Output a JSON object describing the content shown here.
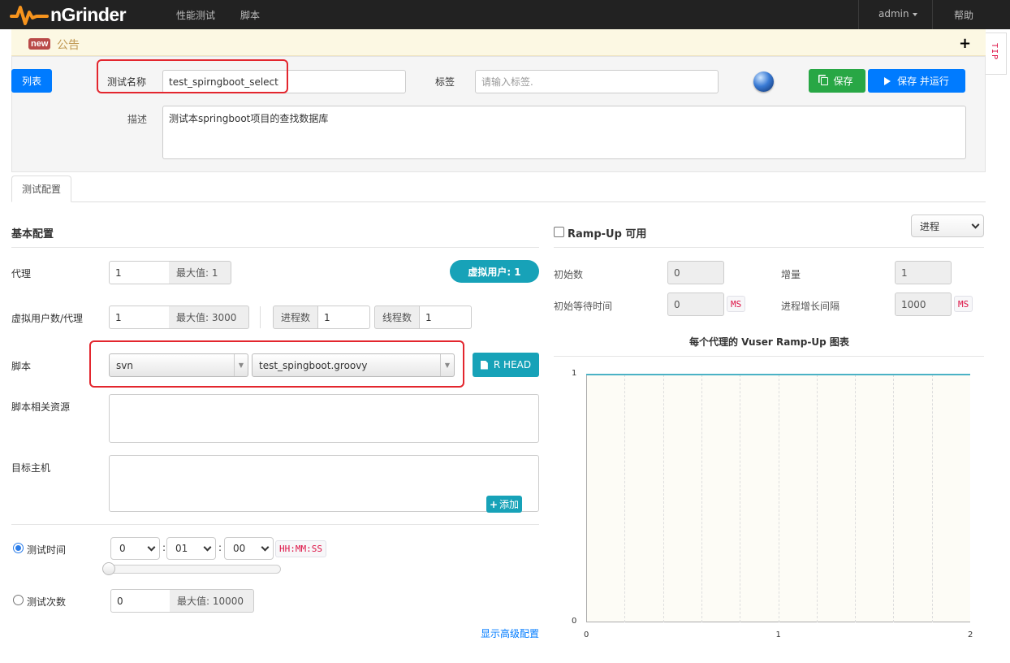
{
  "navbar": {
    "brand": "nGrinder",
    "links": [
      "性能测试",
      "脚本"
    ],
    "user": "admin",
    "help": "帮助"
  },
  "notice": {
    "badge": "new",
    "title": "公告",
    "expand": "+",
    "tip": "TIP"
  },
  "header": {
    "list_button": "列表",
    "test_name_label": "测试名称",
    "test_name_value": "test_spirngboot_select",
    "tag_label": "标签",
    "tag_placeholder": "请输入标签.",
    "save_button": "保存",
    "save_run_button": "保存 并运行",
    "desc_label": "描述",
    "desc_value": "测试本springboot项目的查找数据库"
  },
  "tabs": [
    "测试配置"
  ],
  "basic": {
    "title": "基本配置",
    "agent_label": "代理",
    "agent_value": "1",
    "agent_max": "最大值: 1",
    "vuser_badge": "虚拟用户: 1",
    "vuser_per_agent_label": "虚拟用户数/代理",
    "vuser_value": "1",
    "vuser_max": "最大值: 3000",
    "process_label": "进程数",
    "process_value": "1",
    "thread_label": "线程数",
    "thread_value": "1",
    "script_label": "脚本",
    "script_repo": "svn",
    "script_file": "test_spingboot.groovy",
    "rhead_button": "R HEAD",
    "resources_label": "脚本相关资源",
    "target_host_label": "目标主机",
    "add_button": "添加",
    "duration_label": "测试时间",
    "duration_h": "0",
    "duration_m": "01",
    "duration_s": "00",
    "duration_format": "HH:MM:SS",
    "duration_selected": true,
    "run_count_label": "测试次数",
    "run_count_value": "0",
    "run_count_max": "最大值: 10000",
    "advanced_link": "显示高级配置"
  },
  "rampup": {
    "enable_label": "Ramp-Up 可用",
    "enabled": false,
    "type_select": "进程",
    "initial_count_label": "初始数",
    "initial_count_value": "0",
    "increment_label": "增量",
    "increment_value": "1",
    "initial_sleep_label": "初始等待时间",
    "initial_sleep_value": "0",
    "interval_label": "进程增长间隔",
    "interval_value": "1000",
    "ms_unit": "MS",
    "chart_title": "每个代理的 Vuser Ramp-Up 图表"
  },
  "colors": {
    "primary": "#007bff",
    "success": "#28a745",
    "info": "#17a2b8",
    "highlight": "#e3262e",
    "line": "#4bb2c5"
  },
  "chart_data": {
    "type": "line",
    "title": "每个代理的 Vuser Ramp-Up 图表",
    "x": [
      0,
      2
    ],
    "series": [
      {
        "values": [
          1,
          1
        ]
      }
    ],
    "xticks": [
      "0",
      "1",
      "2"
    ],
    "yticks": [
      "0",
      "1"
    ],
    "xlim": [
      0,
      2
    ],
    "ylim": [
      0,
      1
    ],
    "grid": true
  }
}
